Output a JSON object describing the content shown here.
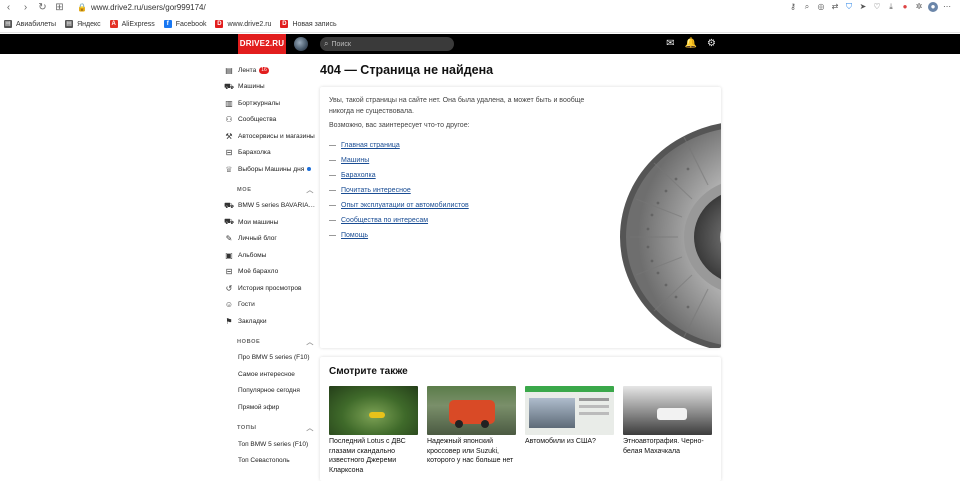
{
  "browser": {
    "url": "www.drive2.ru/users/gor999174/",
    "bookmarks": [
      {
        "label": "Авиабилеты",
        "color": "#555555",
        "glyph": "▤"
      },
      {
        "label": "Яндекс",
        "color": "#555555",
        "glyph": "▤"
      },
      {
        "label": "AliExpress",
        "color": "#e43225",
        "glyph": "A"
      },
      {
        "label": "Facebook",
        "color": "#1877f2",
        "glyph": "f"
      },
      {
        "label": "www.drive2.ru",
        "color": "#e21d1d",
        "glyph": "D"
      },
      {
        "label": "Новая запись",
        "color": "#e21d1d",
        "glyph": "D"
      }
    ]
  },
  "header": {
    "logo": "DRIVE2.RU",
    "search_placeholder": "Поиск"
  },
  "sidebar": {
    "main": [
      {
        "label": "Лента",
        "icon": "feed-icon",
        "glyph": "▤",
        "badge": "16"
      },
      {
        "label": "Машины",
        "icon": "car-icon",
        "glyph": "⛟"
      },
      {
        "label": "Бортжурналы",
        "icon": "logbook-icon",
        "glyph": "▥"
      },
      {
        "label": "Сообщества",
        "icon": "community-icon",
        "glyph": "⚇"
      },
      {
        "label": "Автосервисы и магазины",
        "icon": "service-icon",
        "glyph": "⚒"
      },
      {
        "label": "Барахолка",
        "icon": "market-icon",
        "glyph": "⊟"
      },
      {
        "label": "Выборы Машины дня",
        "icon": "trophy-icon",
        "glyph": "♕",
        "dot": true
      }
    ],
    "sec_my": "МОЕ",
    "my": [
      {
        "label": "BMW 5 series BAVARIA…",
        "icon": "my-car-icon",
        "glyph": "⛟"
      },
      {
        "label": "Мои машины",
        "icon": "cars-icon",
        "glyph": "⛟"
      },
      {
        "label": "Личный блог",
        "icon": "blog-icon",
        "glyph": "✎"
      },
      {
        "label": "Альбомы",
        "icon": "album-icon",
        "glyph": "▣"
      },
      {
        "label": "Моё барахло",
        "icon": "my-market-icon",
        "glyph": "⊟"
      },
      {
        "label": "История просмотров",
        "icon": "history-icon",
        "glyph": "↺"
      },
      {
        "label": "Гости",
        "icon": "guests-icon",
        "glyph": "☺"
      },
      {
        "label": "Закладки",
        "icon": "bookmark-icon",
        "glyph": "⚑"
      }
    ],
    "sec_new": "НОВОЕ",
    "new": [
      "Про BMW 5 series (F10)",
      "Самое интересное",
      "Популярное сегодня",
      "Прямой эфир"
    ],
    "sec_top": "ТОПЫ",
    "top": [
      "Топ BMW 5 series (F10)",
      "Топ Севастополь"
    ]
  },
  "main": {
    "title": "404 — Страница не найдена",
    "message": "Увы, такой страницы на сайте нет. Она была удалена, а может быть и вообще никогда не существовала.",
    "maybe": "Возможно, вас заинтересует что-то другое:",
    "dash": "—",
    "links": [
      "Главная страница",
      "Машины",
      "Барахолка",
      "Почитать интересное",
      "Опыт эксплуатации от автомобилистов",
      "Сообщества по интересам",
      "Помощь"
    ]
  },
  "see_also": {
    "title": "Смотрите также",
    "items": [
      {
        "caption": "Последний Lotus с ДВС глазами скандально известного Джереми Кларксона"
      },
      {
        "caption": "Надежный японский кроссовер или Suzuki, которого у нас больше нет"
      },
      {
        "caption": "Автомобили из США?"
      },
      {
        "caption": "Этноавтография. Черно-белая Махачкала"
      }
    ]
  }
}
